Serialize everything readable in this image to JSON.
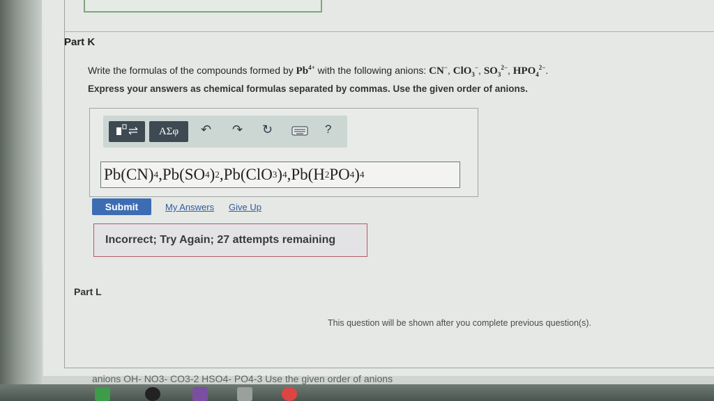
{
  "part_k": {
    "title": "Part K",
    "question_prefix": "Write the formulas of the compounds formed by",
    "cation": "Pb",
    "cation_charge": "4+",
    "question_mid": "with the following anions:",
    "anions": [
      {
        "formula": "CN",
        "sub": "",
        "charge": "−",
        "sep": ", "
      },
      {
        "formula": "ClO",
        "sub": "3",
        "charge": "−",
        "sep": ", "
      },
      {
        "formula": "SO",
        "sub": "3",
        "charge": "2−",
        "sep": ", "
      },
      {
        "formula": "HPO",
        "sub": "4",
        "charge": "2−",
        "sep": "."
      }
    ],
    "instructions": "Express your answers as chemical formulas separated by commas. Use the given order of anions.",
    "toolbar": {
      "template_icon": "template-icon",
      "greek_label": "ΑΣφ",
      "undo_icon": "undo-icon",
      "redo_icon": "redo-icon",
      "reset_icon": "reset-icon",
      "keyboard_icon": "keyboard-icon",
      "help_label": "?"
    },
    "answer": {
      "parts": [
        {
          "t": "Pb(CN)"
        },
        {
          "s": "4"
        },
        {
          "t": ",Pb(SO"
        },
        {
          "s": "4"
        },
        {
          "t": ")"
        },
        {
          "s": "2"
        },
        {
          "t": ",Pb(ClO"
        },
        {
          "s": "3"
        },
        {
          "t": ")"
        },
        {
          "s": "4"
        },
        {
          "t": ",Pb(H"
        },
        {
          "s": "2"
        },
        {
          "t": " PO"
        },
        {
          "s": "4"
        },
        {
          "t": ")"
        },
        {
          "s": "4"
        }
      ]
    },
    "submit_label": "Submit",
    "my_answers_label": "My Answers",
    "give_up_label": "Give Up",
    "feedback": "Incorrect; Try Again; 27 attempts remaining"
  },
  "part_l": {
    "title": "Part L",
    "notice": "This question will be shown after you complete previous question(s)."
  },
  "footer_text": "anions OH- NO3- CO3-2 HSO4- PO4-3  Use the given order of anions"
}
